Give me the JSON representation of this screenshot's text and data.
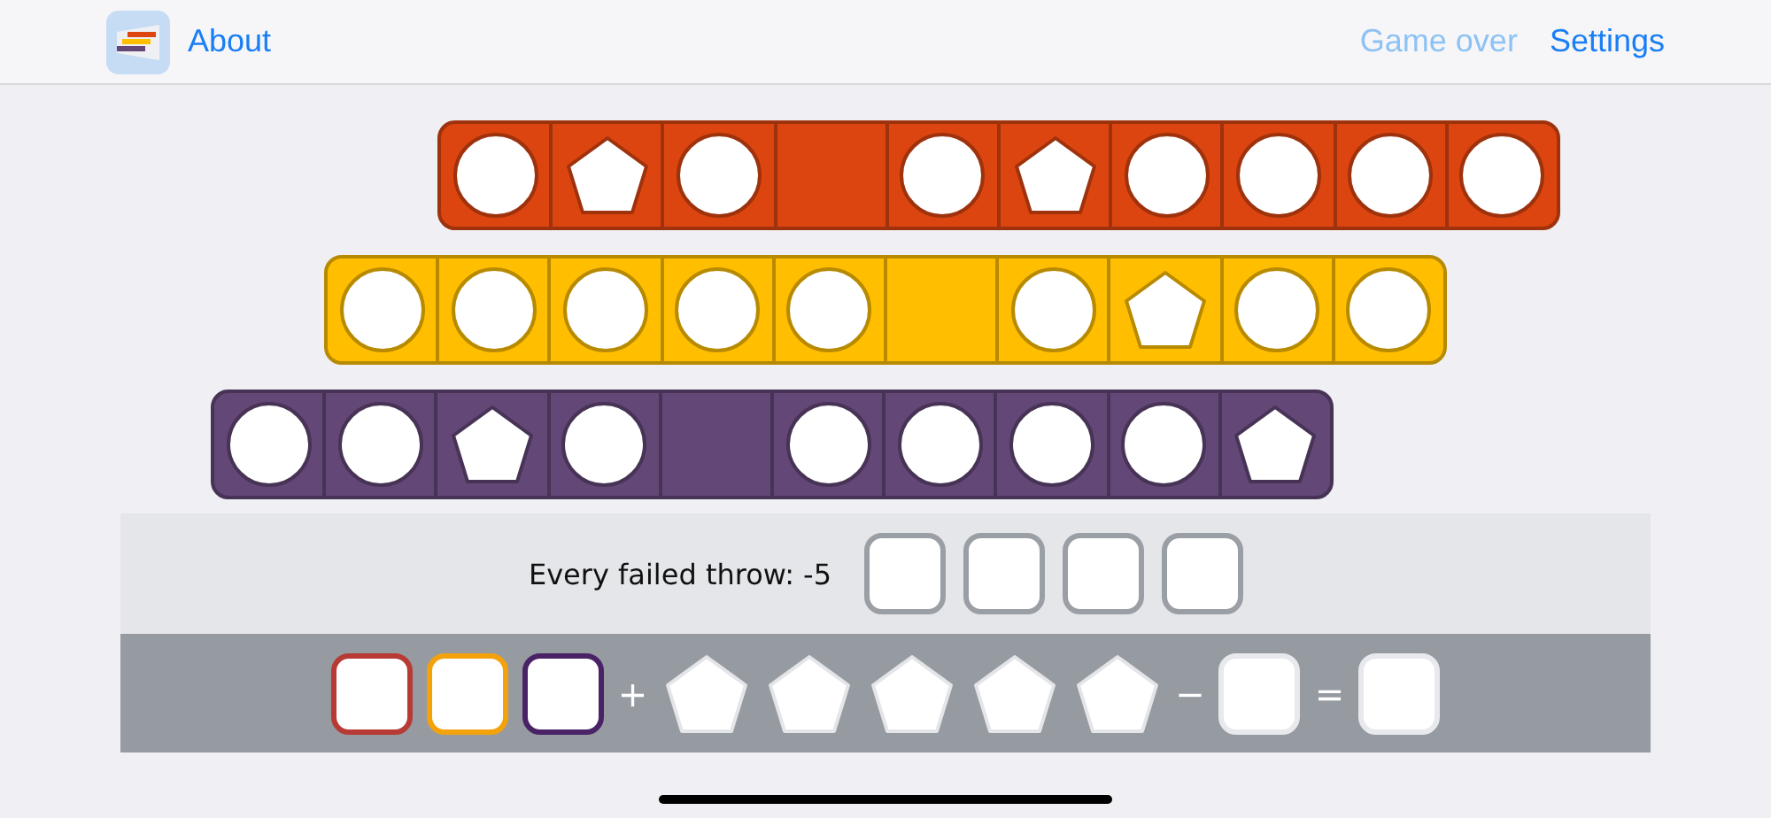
{
  "header": {
    "about": "About",
    "links": [
      {
        "label": "Game over",
        "disabled": true
      },
      {
        "label": "Settings",
        "disabled": false
      }
    ]
  },
  "rows": [
    {
      "color": "#dc4510",
      "cells": [
        {
          "kind": "circle"
        },
        {
          "kind": "pentagon"
        },
        {
          "kind": "circle"
        },
        {
          "kind": "empty"
        },
        {
          "kind": "circle"
        },
        {
          "kind": "pentagon"
        },
        {
          "kind": "circle"
        },
        {
          "kind": "circle"
        },
        {
          "kind": "circle"
        },
        {
          "kind": "circle"
        }
      ]
    },
    {
      "color": "#ffbf00",
      "cells": [
        {
          "kind": "circle"
        },
        {
          "kind": "circle"
        },
        {
          "kind": "circle"
        },
        {
          "kind": "circle"
        },
        {
          "kind": "circle"
        },
        {
          "kind": "empty"
        },
        {
          "kind": "circle"
        },
        {
          "kind": "pentagon"
        },
        {
          "kind": "circle"
        },
        {
          "kind": "circle"
        }
      ]
    },
    {
      "color": "#634776",
      "cells": [
        {
          "kind": "circle"
        },
        {
          "kind": "circle"
        },
        {
          "kind": "pentagon"
        },
        {
          "kind": "circle"
        },
        {
          "kind": "empty"
        },
        {
          "kind": "circle"
        },
        {
          "kind": "circle"
        },
        {
          "kind": "circle"
        },
        {
          "kind": "circle"
        },
        {
          "kind": "pentagon"
        }
      ]
    }
  ],
  "penalty": {
    "label": "Every failed throw: -5",
    "boxes": [
      {
        "checked": false
      },
      {
        "checked": false
      },
      {
        "checked": false
      },
      {
        "checked": false
      }
    ]
  },
  "score": [
    {
      "kind": "box",
      "color": "#b83a34"
    },
    {
      "kind": "box",
      "color": "#f4a20c"
    },
    {
      "kind": "box",
      "color": "#4a2366"
    },
    {
      "kind": "operator",
      "text": "+"
    },
    {
      "kind": "pentagon"
    },
    {
      "kind": "pentagon"
    },
    {
      "kind": "pentagon"
    },
    {
      "kind": "pentagon"
    },
    {
      "kind": "pentagon"
    },
    {
      "kind": "operator",
      "text": "−"
    },
    {
      "kind": "box",
      "color": "#e8e9ec"
    },
    {
      "kind": "operator",
      "text": "="
    },
    {
      "kind": "box",
      "color": "#e8e9ec"
    }
  ]
}
